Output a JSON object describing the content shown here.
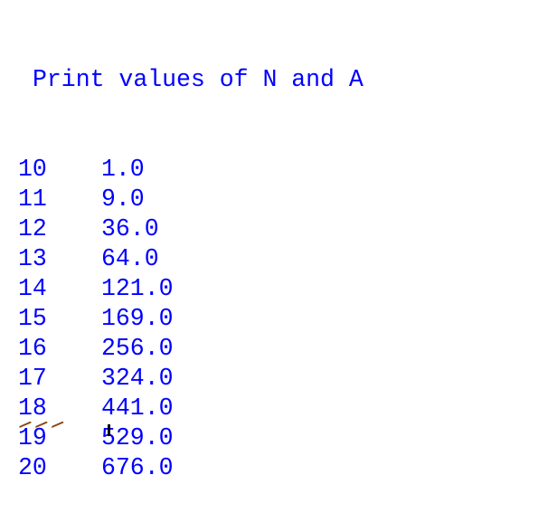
{
  "shell": {
    "heading": "Print values of N and A",
    "rows": [
      {
        "n": "10",
        "a": "1.0"
      },
      {
        "n": "11",
        "a": "9.0"
      },
      {
        "n": "12",
        "a": "36.0"
      },
      {
        "n": "13",
        "a": "64.0"
      },
      {
        "n": "14",
        "a": "121.0"
      },
      {
        "n": "15",
        "a": "169.0"
      },
      {
        "n": "16",
        "a": "256.0"
      },
      {
        "n": "17",
        "a": "324.0"
      },
      {
        "n": "18",
        "a": "441.0"
      },
      {
        "n": "19",
        "a": "529.0"
      },
      {
        "n": "20",
        "a": "676.0"
      }
    ],
    "prompt": ">>>"
  },
  "colors": {
    "output_text": "#0000ff",
    "prompt": "#8b4513",
    "background": "#ffffff",
    "cursor": "#000000"
  }
}
